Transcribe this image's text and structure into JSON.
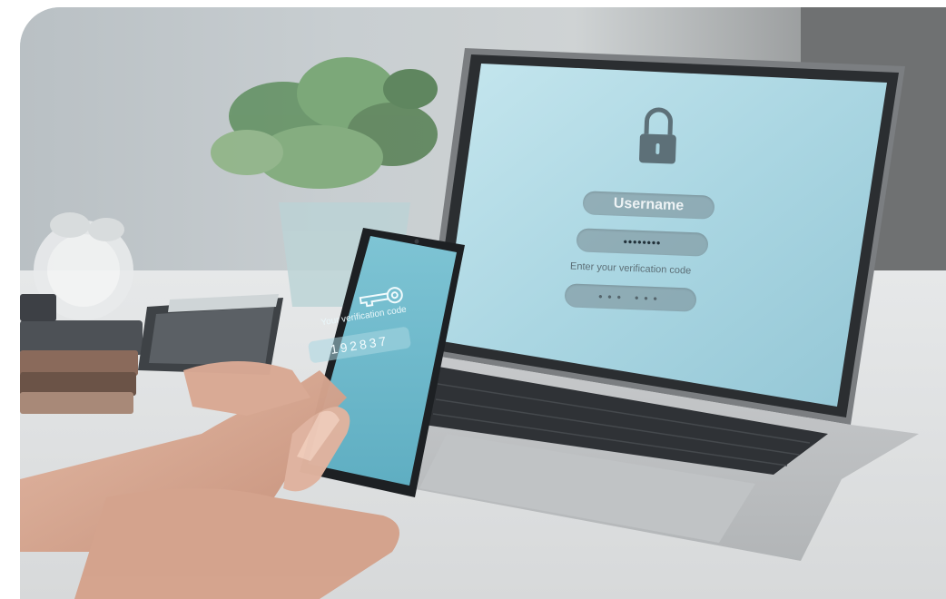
{
  "laptop_screen": {
    "username_label": "Username",
    "password_mask": "••••••••",
    "verification_prompt": "Enter your verification code",
    "code_mask": "••• •••",
    "lock_icon": "padlock-icon"
  },
  "phone_screen": {
    "key_icon": "key-icon",
    "caption": "Your verification code",
    "code": "192837"
  },
  "colors": {
    "screen_blue": "#a8d6e2",
    "phone_blue": "#6fbcce",
    "field_gray": "#7f9299"
  }
}
